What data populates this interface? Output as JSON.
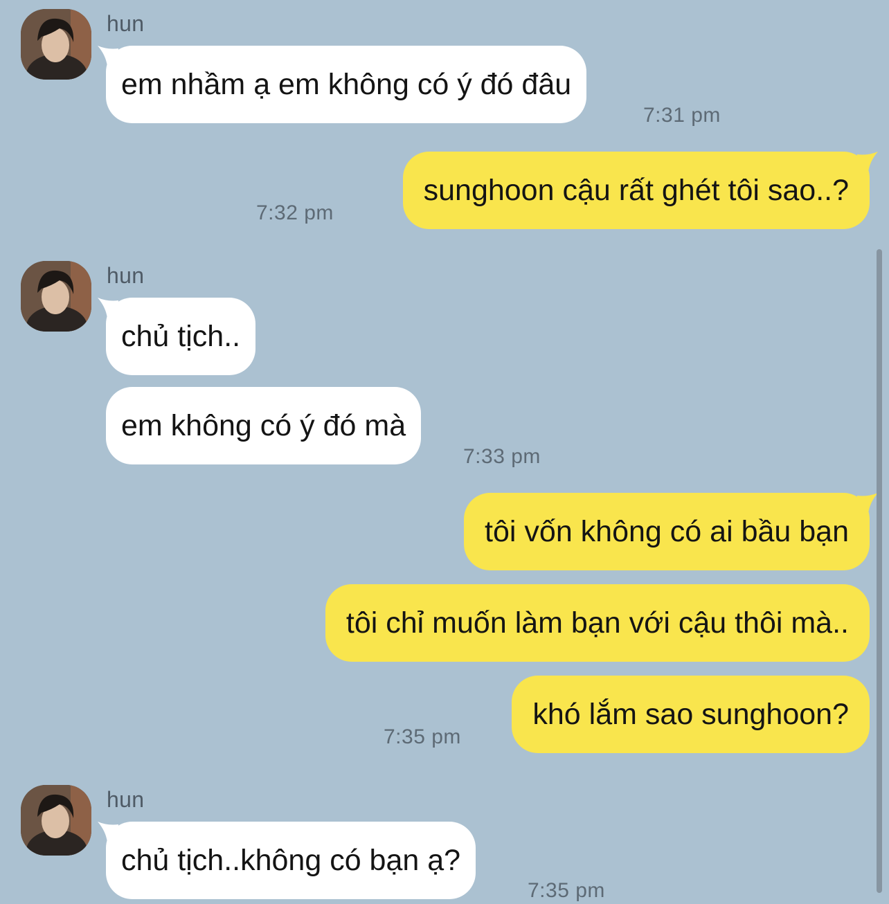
{
  "contact": {
    "name": "hun"
  },
  "colors": {
    "background": "#abc1d1",
    "incoming_bubble": "#ffffff",
    "outgoing_bubble": "#f9e54d",
    "timestamp": "#5d6a75"
  },
  "messages": [
    {
      "direction": "incoming",
      "text": "em nhầm ạ em không có ý đó đâu",
      "time": "7:31 pm"
    },
    {
      "direction": "outgoing",
      "text": "sunghoon cậu rất ghét tôi sao..?",
      "time": "7:32 pm"
    },
    {
      "direction": "incoming",
      "text": "chủ tịch..",
      "time": ""
    },
    {
      "direction": "incoming",
      "text": "em không có ý đó mà",
      "time": "7:33 pm"
    },
    {
      "direction": "outgoing",
      "text": "tôi vốn không có ai bầu bạn",
      "time": ""
    },
    {
      "direction": "outgoing",
      "text": "tôi chỉ muốn làm bạn với cậu thôi mà..",
      "time": ""
    },
    {
      "direction": "outgoing",
      "text": "khó lắm sao sunghoon?",
      "time": "7:35 pm"
    },
    {
      "direction": "incoming",
      "text": "chủ tịch..không có bạn ạ?",
      "time": "7:35 pm"
    }
  ]
}
